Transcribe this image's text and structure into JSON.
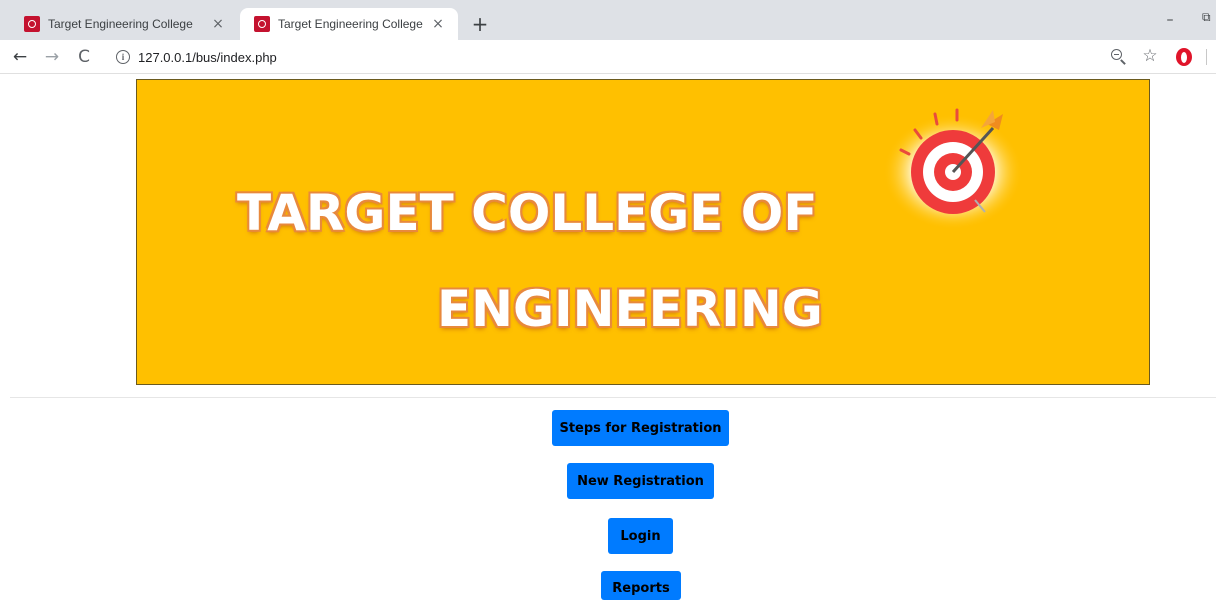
{
  "browser": {
    "tabs": [
      {
        "title": "Target Engineering College",
        "close": "×"
      },
      {
        "title": "Target Engineering College",
        "close": "×"
      }
    ],
    "new_tab": "+",
    "minimize": "–",
    "restore": "⧉",
    "nav": {
      "back": "←",
      "forward": "→",
      "reload": "C"
    },
    "info_glyph": "i",
    "url": "127.0.0.1/bus/index.php",
    "bookmark_glyph": "☆"
  },
  "banner": {
    "line1": "TARGET COLLEGE OF",
    "line2": "ENGINEERING"
  },
  "buttons": {
    "steps": "Steps for Registration",
    "new_registration": "New Registration",
    "login": "Login",
    "reports": "Reports"
  },
  "colors": {
    "banner_bg": "#ffc000",
    "button_bg": "#007bff",
    "tab_favicon": "#c4122f"
  },
  "icons": [
    "target-logo-icon",
    "zoom-icon",
    "star-icon",
    "opera-icon",
    "info-icon"
  ]
}
